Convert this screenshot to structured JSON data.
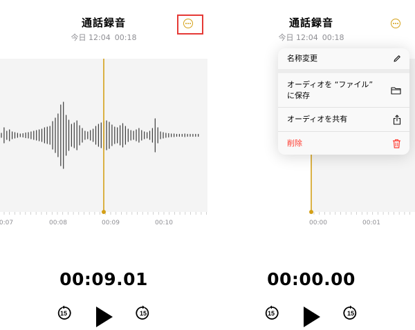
{
  "left": {
    "title": "通話録音",
    "date": "今日 12:04",
    "duration": "00:18",
    "ruler": [
      "0:07",
      "00:08",
      "00:09",
      "00:10"
    ],
    "time": "00:09.01"
  },
  "right": {
    "title": "通話録音",
    "date": "今日 12:04",
    "duration": "00:18",
    "ruler": [
      "00:00",
      "00:01"
    ],
    "time": "00:00.00",
    "menu": {
      "rename": "名称変更",
      "save_line1": "オーディオを “ファイル”",
      "save_line2": "に保存",
      "share": "オーディオを共有",
      "delete": "削除"
    }
  },
  "controls": {
    "skip_back": "15",
    "skip_forward": "15"
  },
  "colors": {
    "accent": "#d4a017",
    "highlight": "#e53935",
    "danger": "#ff3b30",
    "wave": "#3a3a3a"
  }
}
